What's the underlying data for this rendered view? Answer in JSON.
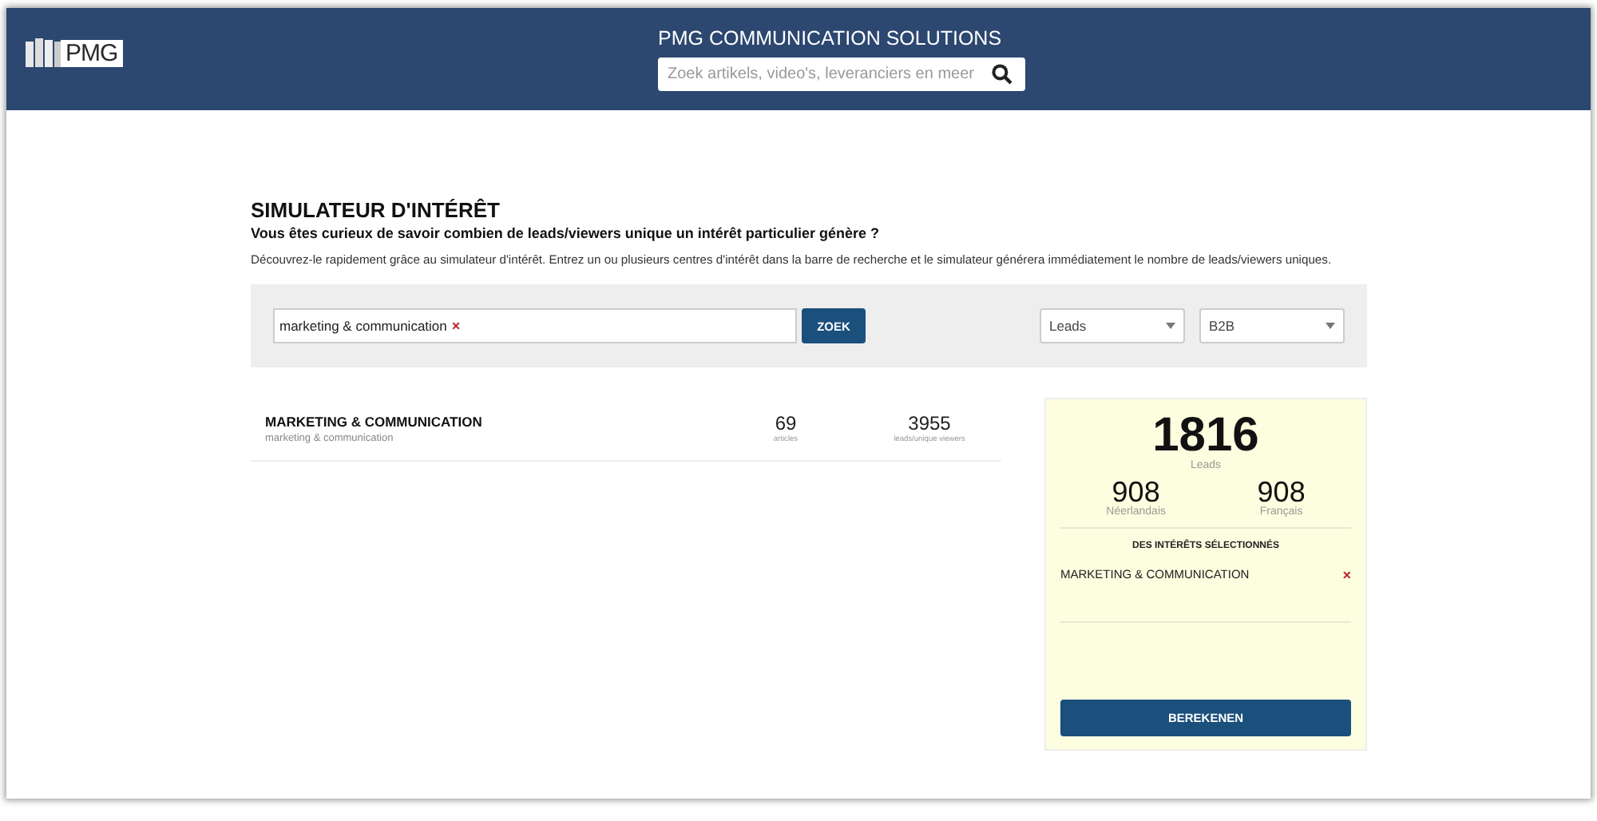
{
  "header": {
    "logo": "PMG",
    "site_title": "PMG COMMUNICATION SOLUTIONS",
    "search": {
      "placeholder": "Zoek artikels, video's, leveranciers en meer"
    }
  },
  "simulator": {
    "title": "SIMULATEUR D'INTÉRÊT",
    "subtitle": "Vous êtes curieux de savoir combien de leads/viewers unique un intérêt particulier génère ?",
    "description": "Découvrez-le rapidement grâce au simulateur d'intérêt. Entrez un ou plusieurs centres d'intérêt dans la barre de recherche et le simulateur générera immédiatement le nombre de leads/viewers uniques.",
    "tags": [
      {
        "label": "marketing & communication",
        "remove": "×"
      }
    ],
    "search_button": "ZOEK",
    "dropdowns": [
      {
        "value": "Leads"
      },
      {
        "value": "B2B"
      }
    ]
  },
  "results": [
    {
      "title": "MARKETING & COMMUNICATION",
      "subtitle": "marketing & communication",
      "articles": "69",
      "articles_label": "articles",
      "viewers": "3955",
      "viewers_label": "leads/unique viewers"
    }
  ],
  "summary": {
    "total": "1816",
    "total_label": "Leads",
    "split": [
      {
        "value": "908",
        "label": "Néerlandais"
      },
      {
        "value": "908",
        "label": "Français"
      }
    ],
    "selected_heading": "DES INTÉRÊTS SÉLECTIONNÉS",
    "selected": [
      {
        "label": "MARKETING & COMMUNICATION",
        "remove": "×"
      }
    ],
    "button": "BEREKENEN"
  }
}
